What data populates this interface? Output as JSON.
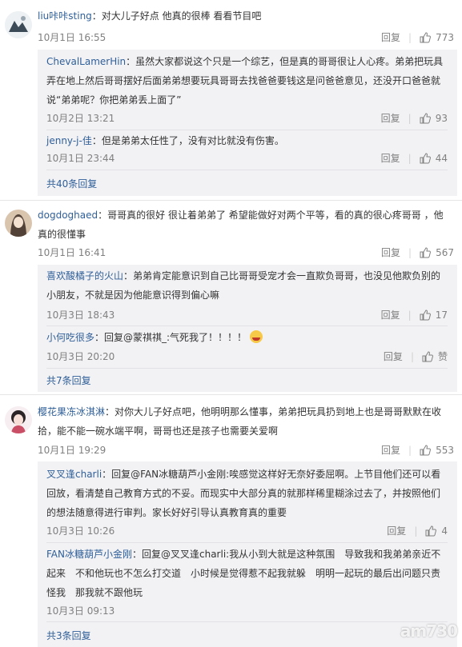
{
  "labels": {
    "reply": "回复",
    "sep": "|"
  },
  "comments": [
    {
      "user": "liu咔咔sting",
      "text": "：对大儿子好点 他真的很棒 看看节目吧",
      "time": "10月1日 16:55",
      "likes": "773",
      "replies": [
        {
          "user": "ChevalLamerHin",
          "text": "：虽然大家都说这个只是一个综艺，但是真的哥哥很让人心疼。弟弟把玩具弄在地上然后哥哥摆好后面弟弟想要玩具哥哥去找爸爸要钱这是问爸爸意见，还没开口爸爸就说“弟弟呢？你把弟弟丢上面了”",
          "time": "10月2日 13:21",
          "likes": "93"
        },
        {
          "user": "jenny-j-佳",
          "text": "：但是弟弟太任性了，没有对比就没有伤害。",
          "time": "10月1日 23:44",
          "likes": "44"
        }
      ],
      "more": "共40条回复"
    },
    {
      "user": "dogdoghaed",
      "text": "：哥哥真的很好 很让着弟弟了 希望能做好对两个平等，看的真的很心疼哥哥 ，他真的很懂事",
      "time": "10月1日 16:41",
      "likes": "567",
      "replies": [
        {
          "user": "喜欢酸橘子的火山",
          "text": "：弟弟肯定能意识到自己比哥哥受宠才会一直欺负哥哥，也没见他欺负别的小朋友，不就是因为他能意识得到偏心嘛",
          "time": "10月3日 18:43",
          "likes": "17"
        },
        {
          "user": "小何吃很多",
          "text": "：回复@蒙祺祺_:气死我了！！！！",
          "time": "10月3日 20:20",
          "likes": "赞"
        }
      ],
      "more": "共7条回复"
    },
    {
      "user": "樱花果冻冰淇淋",
      "text": "：对你大儿子好点吧，他明明那么懂事，弟弟把玩具扔到地上也是哥哥默默在收拾，能不能一碗水端平啊，哥哥也还是孩子也需要关爱啊",
      "time": "10月1日 19:29",
      "likes": "553",
      "replies": [
        {
          "user": "叉叉逢charli",
          "text": "：回复@FAN冰糖葫芦小金刚:唉感觉这样好无奈好委屈啊。上节目他们还可以看回放，看清楚自己教育方式的不妥。而现实中大部分真的就那样稀里糊涂过去了，并按照他们的想法随意得进行审判。家长好好引导认真教育真的重要",
          "time": "10月3日 10:26",
          "likes": "4"
        },
        {
          "user": "FAN冰糖葫芦小金刚",
          "text": "：回复@叉叉逢charli:我从小到大就是这种氛围　导致我和我弟弟亲近不起来　不和他玩也不怎么打交道　小时候是觉得惹不起我就躲　明明一起玩的最后出问题只责怪我　那我就不跟他玩",
          "time": "10月3日 09:13",
          "likes": ""
        }
      ],
      "more": "共3条回复"
    }
  ],
  "watermark": "am730"
}
